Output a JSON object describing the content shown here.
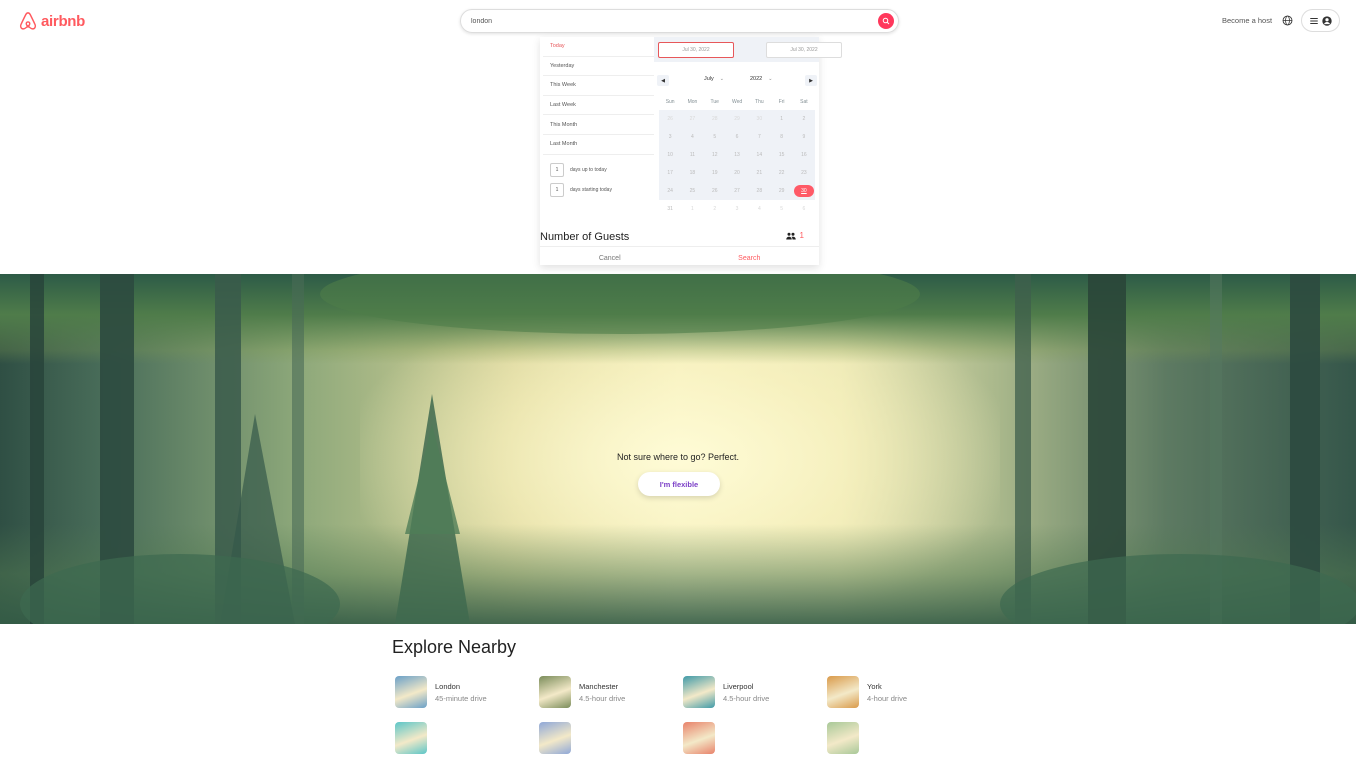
{
  "header": {
    "logo_text": "airbnb",
    "search_value": "london",
    "host_label": "Become a host"
  },
  "picker": {
    "ranges": [
      "Today",
      "Yesterday",
      "This Week",
      "Last Week",
      "This Month",
      "Last Month"
    ],
    "range_inputs": [
      {
        "value": "1",
        "label": "days up to today"
      },
      {
        "value": "1",
        "label": "days starting today"
      }
    ],
    "start_date": "Jul 30, 2022",
    "end_date": "Jul 30, 2022",
    "month": "July",
    "year": "2022",
    "weekdays": [
      "Sun",
      "Mon",
      "Tue",
      "Wed",
      "Thu",
      "Fri",
      "Sat"
    ],
    "days": [
      {
        "n": "26",
        "p": true
      },
      {
        "n": "27",
        "p": true
      },
      {
        "n": "28",
        "p": true
      },
      {
        "n": "29",
        "p": true
      },
      {
        "n": "30",
        "p": true
      },
      {
        "n": "1"
      },
      {
        "n": "2"
      },
      {
        "n": "3"
      },
      {
        "n": "4"
      },
      {
        "n": "5"
      },
      {
        "n": "6"
      },
      {
        "n": "7"
      },
      {
        "n": "8"
      },
      {
        "n": "9"
      },
      {
        "n": "10"
      },
      {
        "n": "11"
      },
      {
        "n": "12"
      },
      {
        "n": "13"
      },
      {
        "n": "14"
      },
      {
        "n": "15"
      },
      {
        "n": "16"
      },
      {
        "n": "17"
      },
      {
        "n": "18"
      },
      {
        "n": "19"
      },
      {
        "n": "20"
      },
      {
        "n": "21"
      },
      {
        "n": "22"
      },
      {
        "n": "23"
      },
      {
        "n": "24"
      },
      {
        "n": "25"
      },
      {
        "n": "26"
      },
      {
        "n": "27"
      },
      {
        "n": "28"
      },
      {
        "n": "29"
      },
      {
        "n": "30",
        "today": true
      },
      {
        "n": "31"
      },
      {
        "n": "1",
        "p": true
      },
      {
        "n": "2",
        "p": true
      },
      {
        "n": "3",
        "p": true
      },
      {
        "n": "4",
        "p": true
      },
      {
        "n": "5",
        "p": true
      },
      {
        "n": "6",
        "p": true
      }
    ],
    "guests_label": "Number of Guests",
    "guests_count": "1",
    "cancel_label": "Cancel",
    "search_label": "Search"
  },
  "hero": {
    "tagline": "Not sure where to go? Perfect.",
    "button_label": "I'm flexible"
  },
  "explore": {
    "title": "Explore Nearby",
    "items": [
      {
        "name": "London",
        "distance": "45-minute drive",
        "color": "#6aa0c8"
      },
      {
        "name": "Manchester",
        "distance": "4.5-hour drive",
        "color": "#7a8c5a"
      },
      {
        "name": "Liverpool",
        "distance": "4.5-hour drive",
        "color": "#3f9aa8"
      },
      {
        "name": "York",
        "distance": "4-hour drive",
        "color": "#d99a4a"
      },
      {
        "name": "",
        "distance": "",
        "color": "#5cc6c8"
      },
      {
        "name": "",
        "distance": "",
        "color": "#8fa8d8"
      },
      {
        "name": "",
        "distance": "",
        "color": "#e8826a"
      },
      {
        "name": "",
        "distance": "",
        "color": "#a8c898"
      }
    ]
  },
  "colors": {
    "brand": "#FF5A5F",
    "flexible": "#7b3fc7"
  }
}
